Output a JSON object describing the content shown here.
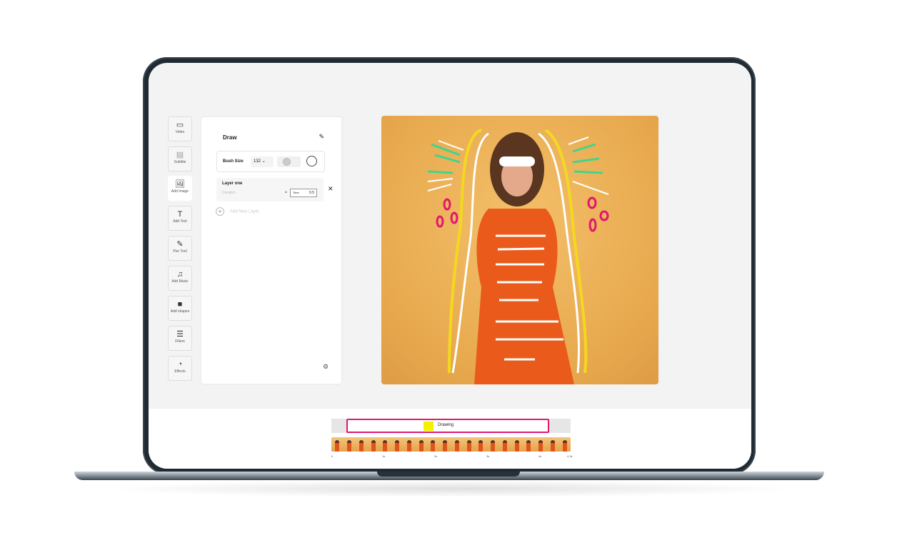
{
  "sidebar": {
    "items": [
      {
        "label": "Video",
        "icon": "video-icon"
      },
      {
        "label": "Subtitle",
        "icon": "subtitle-icon"
      },
      {
        "label": "Add Image",
        "icon": "image-icon"
      },
      {
        "label": "Add Text",
        "icon": "text-icon"
      },
      {
        "label": "Pen Tool",
        "icon": "pen-icon"
      },
      {
        "label": "Add Music",
        "icon": "music-icon"
      },
      {
        "label": "Add shapes",
        "icon": "shapes-icon"
      },
      {
        "label": "Filters",
        "icon": "filters-icon"
      },
      {
        "label": "Effects",
        "icon": "effects-icon"
      }
    ]
  },
  "panel": {
    "title": "Draw",
    "brush_label": "Bush Size",
    "brush_size": "132",
    "layer_name": "Layer one",
    "duration_label": "Duration",
    "time_label": "Time",
    "time_value": "0.5",
    "add_layer": "Add New Layer"
  },
  "timeline": {
    "clip_label": "Drawing",
    "clip_color": "#f4f000",
    "accent": "#e0176f",
    "ticks": [
      "0",
      "1s",
      "2s",
      "3s",
      "4s",
      "4.3s"
    ]
  }
}
